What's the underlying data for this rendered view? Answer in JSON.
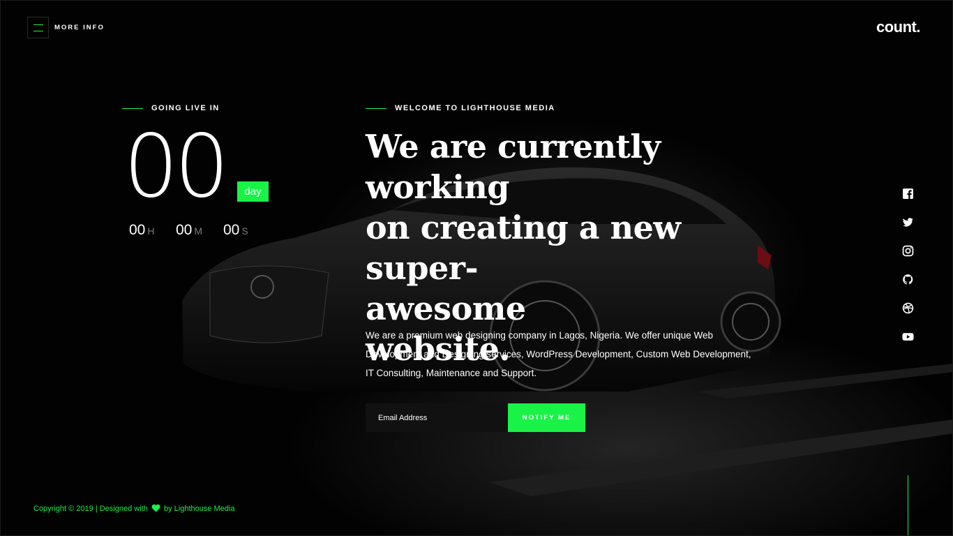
{
  "header": {
    "menu_label": "MORE INFO",
    "logo_text": "count."
  },
  "countdown": {
    "section_label": "GOING LIVE IN",
    "days_value": "00",
    "days_unit": "day",
    "hours_value": "00",
    "hours_unit": "H",
    "minutes_value": "00",
    "minutes_unit": "M",
    "seconds_value": "00",
    "seconds_unit": "S"
  },
  "main": {
    "section_label": "WELCOME TO LIGHTHOUSE MEDIA",
    "headline_line1": "We are currently working",
    "headline_line2": "on creating a new super-",
    "headline_line3": "awesome",
    "headline_line4": "website.",
    "description": "We are a premium web designing company in Lagos, Nigeria. We offer unique Web Development and Designing services, WordPress Development, Custom Web Development, IT Consulting, Maintenance and Support.",
    "email_placeholder": "Email Address",
    "notify_label": "NOTIFY ME"
  },
  "social": {
    "items": [
      "facebook-icon",
      "twitter-icon",
      "instagram-icon",
      "github-icon",
      "dribbble-icon",
      "youtube-icon"
    ]
  },
  "footer": {
    "copyright_prefix": "Copyright © 2019 | Designed with",
    "copyright_suffix": "by Lighthouse Media"
  },
  "colors": {
    "accent": "#19f347",
    "background": "#000000"
  }
}
